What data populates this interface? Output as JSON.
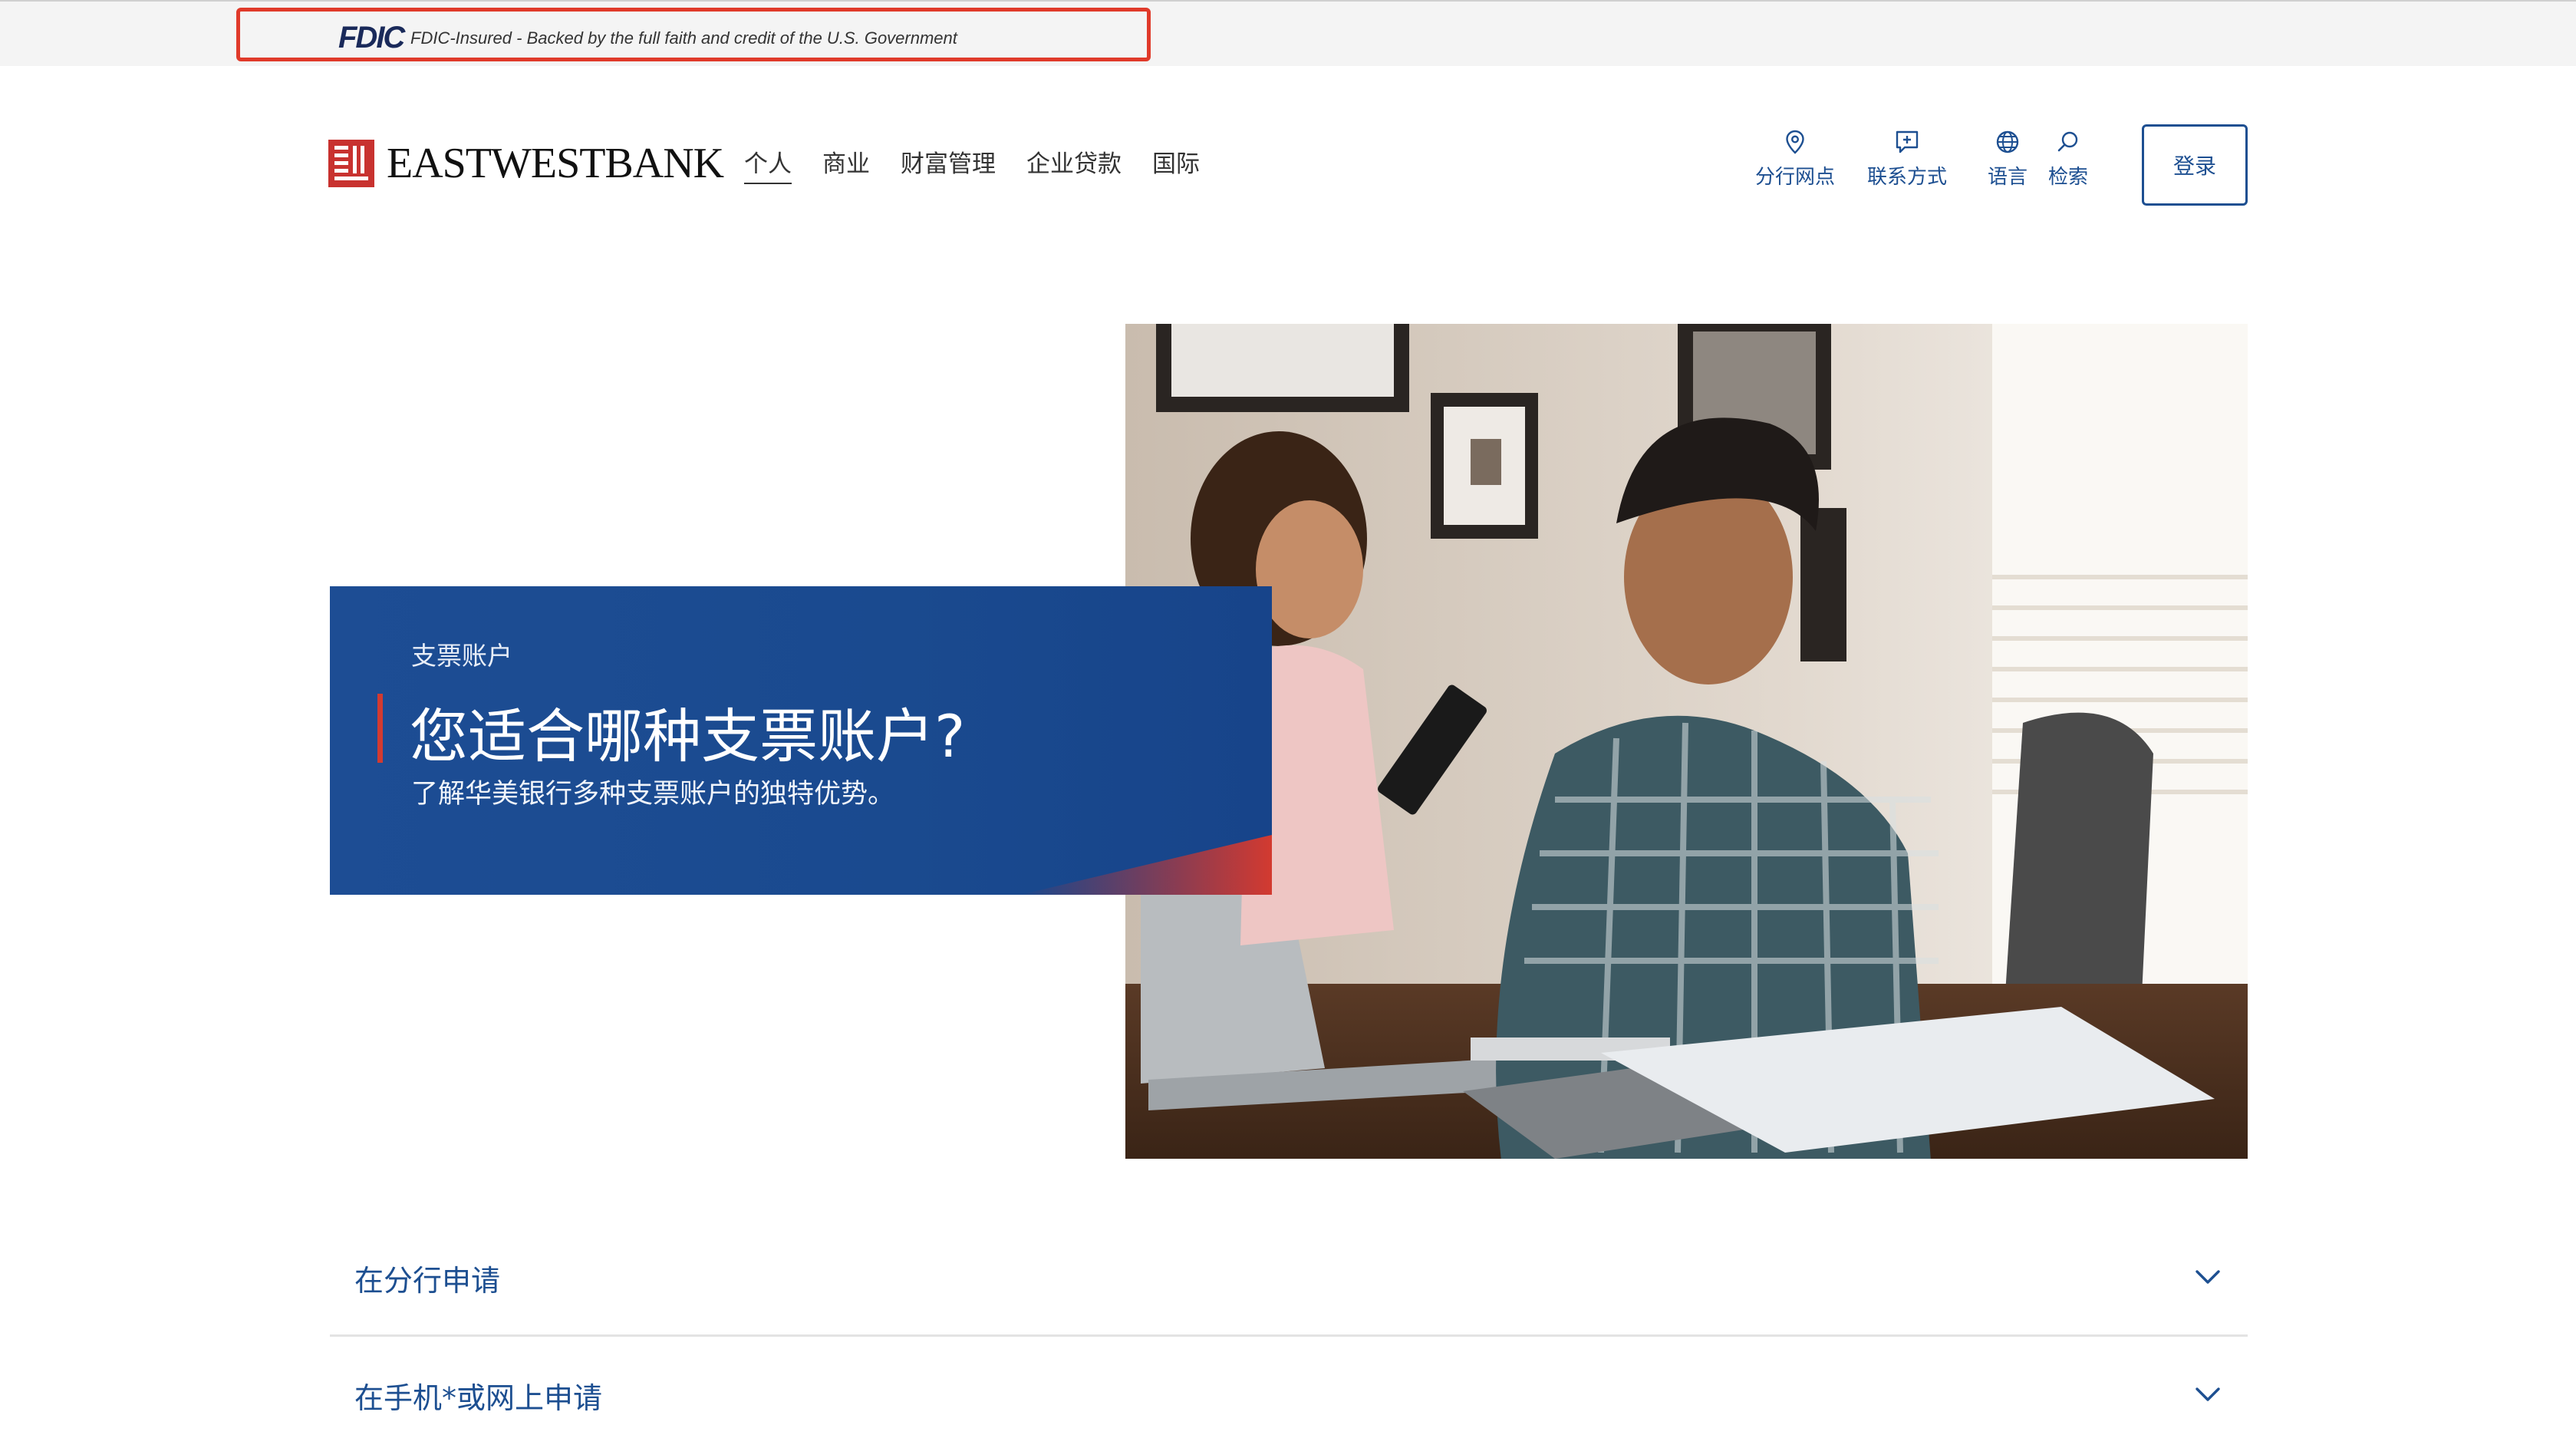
{
  "fdic": {
    "logo": "FDIC",
    "text": "FDIC-Insured - Backed by the full faith and credit of the U.S. Government"
  },
  "header": {
    "brand": "EASTWESTBANK",
    "nav": [
      "个人",
      "商业",
      "财富管理",
      "企业贷款",
      "国际"
    ],
    "utilities": [
      {
        "label": "分行网点",
        "icon": "location-pin-icon"
      },
      {
        "label": "联系方式",
        "icon": "chat-plus-icon"
      },
      {
        "label": "语言",
        "icon": "globe-icon"
      },
      {
        "label": "检索",
        "icon": "search-icon"
      }
    ],
    "login": "登录"
  },
  "hero": {
    "eyebrow": "支票账户",
    "title": "您适合哪种支票账户?",
    "subtitle": "了解华美银行多种支票账户的独特优势。"
  },
  "accordions": [
    {
      "label": "在分行申请"
    },
    {
      "label": "在手机*或网上申请"
    }
  ],
  "colors": {
    "brand_blue": "#1d4f91",
    "brand_red": "#c8322f",
    "fdic_outline": "#e03a2a"
  }
}
